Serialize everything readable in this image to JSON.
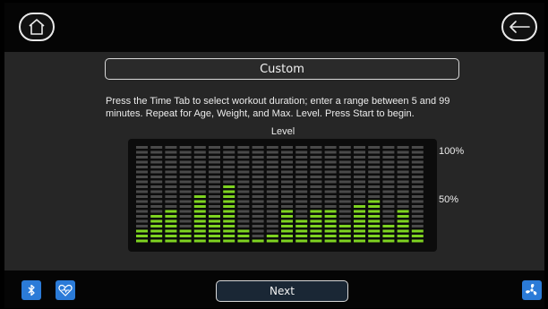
{
  "header": {
    "home_icon": "home-icon",
    "back_icon": "arrow-left-icon"
  },
  "main": {
    "title": "Custom",
    "instructions": "Press the Time Tab to select workout duration; enter a range between 5 and 99 minutes. Repeat for Age, Weight, and Max. Level. Press Start to begin.",
    "chart_label": "Level",
    "tick_100": "100%",
    "tick_50": "50%"
  },
  "chart_data": {
    "type": "bar",
    "title": "Level",
    "ylim": [
      0,
      100
    ],
    "y_ticks": [
      "100%",
      "50%"
    ],
    "segments_per_column": 20,
    "lit_color": "#7ed321",
    "unlit_color": "#4a4a4a",
    "values": [
      3,
      6,
      7,
      3,
      10,
      6,
      12,
      3,
      1,
      2,
      7,
      5,
      7,
      7,
      4,
      8,
      9,
      4,
      7,
      3
    ]
  },
  "footer": {
    "next_label": "Next",
    "bluetooth_icon": "bluetooth-icon",
    "heart_icon": "heart-rate-icon",
    "fan_icon": "fan-icon"
  },
  "colors": {
    "accent_blue": "#2b7bd8",
    "bar_green": "#7ed321"
  }
}
